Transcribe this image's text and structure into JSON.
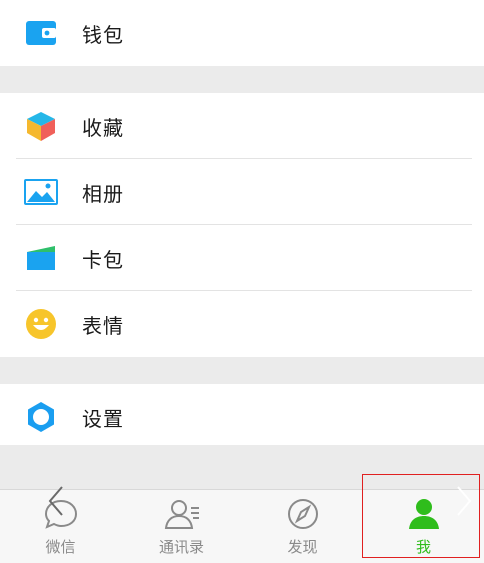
{
  "menu": {
    "wallet": {
      "label": "钱包",
      "icon": "wallet-icon"
    },
    "favorites": {
      "label": "收藏",
      "icon": "cube-icon"
    },
    "album": {
      "label": "相册",
      "icon": "photo-icon"
    },
    "cards": {
      "label": "卡包",
      "icon": "card-icon"
    },
    "stickers": {
      "label": "表情",
      "icon": "smiley-icon"
    },
    "settings": {
      "label": "设置",
      "icon": "gear-icon"
    }
  },
  "tabs": [
    {
      "label": "微信",
      "icon": "chat-bubble-icon",
      "active": false
    },
    {
      "label": "通讯录",
      "icon": "contacts-icon",
      "active": false
    },
    {
      "label": "发现",
      "icon": "compass-icon",
      "active": false
    },
    {
      "label": "我",
      "icon": "person-icon",
      "active": true
    }
  ],
  "colors": {
    "accent_green": "#2fbd1c",
    "wallet_blue": "#1aa3f0",
    "settings_blue": "#1a9ef0",
    "smiley_yellow": "#f7c52b",
    "highlight_red": "#e02020"
  }
}
